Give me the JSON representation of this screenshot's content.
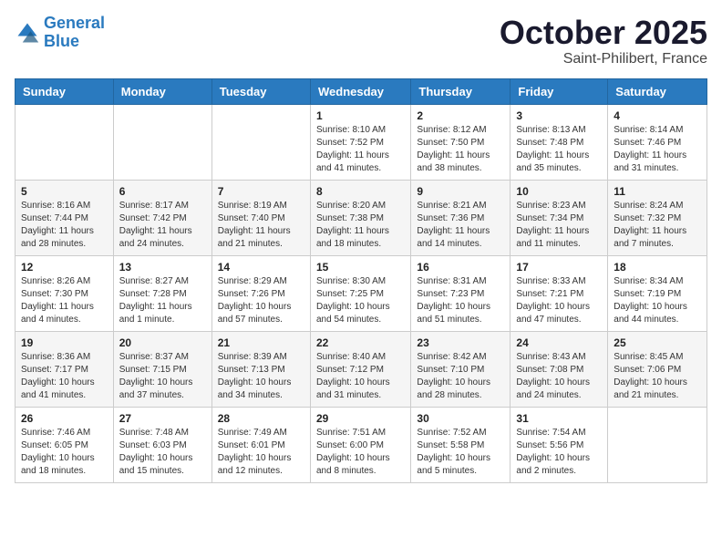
{
  "header": {
    "logo_line1": "General",
    "logo_line2": "Blue",
    "month": "October 2025",
    "location": "Saint-Philibert, France"
  },
  "weekdays": [
    "Sunday",
    "Monday",
    "Tuesday",
    "Wednesday",
    "Thursday",
    "Friday",
    "Saturday"
  ],
  "weeks": [
    [
      {
        "day": "",
        "info": ""
      },
      {
        "day": "",
        "info": ""
      },
      {
        "day": "",
        "info": ""
      },
      {
        "day": "1",
        "info": "Sunrise: 8:10 AM\nSunset: 7:52 PM\nDaylight: 11 hours\nand 41 minutes."
      },
      {
        "day": "2",
        "info": "Sunrise: 8:12 AM\nSunset: 7:50 PM\nDaylight: 11 hours\nand 38 minutes."
      },
      {
        "day": "3",
        "info": "Sunrise: 8:13 AM\nSunset: 7:48 PM\nDaylight: 11 hours\nand 35 minutes."
      },
      {
        "day": "4",
        "info": "Sunrise: 8:14 AM\nSunset: 7:46 PM\nDaylight: 11 hours\nand 31 minutes."
      }
    ],
    [
      {
        "day": "5",
        "info": "Sunrise: 8:16 AM\nSunset: 7:44 PM\nDaylight: 11 hours\nand 28 minutes."
      },
      {
        "day": "6",
        "info": "Sunrise: 8:17 AM\nSunset: 7:42 PM\nDaylight: 11 hours\nand 24 minutes."
      },
      {
        "day": "7",
        "info": "Sunrise: 8:19 AM\nSunset: 7:40 PM\nDaylight: 11 hours\nand 21 minutes."
      },
      {
        "day": "8",
        "info": "Sunrise: 8:20 AM\nSunset: 7:38 PM\nDaylight: 11 hours\nand 18 minutes."
      },
      {
        "day": "9",
        "info": "Sunrise: 8:21 AM\nSunset: 7:36 PM\nDaylight: 11 hours\nand 14 minutes."
      },
      {
        "day": "10",
        "info": "Sunrise: 8:23 AM\nSunset: 7:34 PM\nDaylight: 11 hours\nand 11 minutes."
      },
      {
        "day": "11",
        "info": "Sunrise: 8:24 AM\nSunset: 7:32 PM\nDaylight: 11 hours\nand 7 minutes."
      }
    ],
    [
      {
        "day": "12",
        "info": "Sunrise: 8:26 AM\nSunset: 7:30 PM\nDaylight: 11 hours\nand 4 minutes."
      },
      {
        "day": "13",
        "info": "Sunrise: 8:27 AM\nSunset: 7:28 PM\nDaylight: 11 hours\nand 1 minute."
      },
      {
        "day": "14",
        "info": "Sunrise: 8:29 AM\nSunset: 7:26 PM\nDaylight: 10 hours\nand 57 minutes."
      },
      {
        "day": "15",
        "info": "Sunrise: 8:30 AM\nSunset: 7:25 PM\nDaylight: 10 hours\nand 54 minutes."
      },
      {
        "day": "16",
        "info": "Sunrise: 8:31 AM\nSunset: 7:23 PM\nDaylight: 10 hours\nand 51 minutes."
      },
      {
        "day": "17",
        "info": "Sunrise: 8:33 AM\nSunset: 7:21 PM\nDaylight: 10 hours\nand 47 minutes."
      },
      {
        "day": "18",
        "info": "Sunrise: 8:34 AM\nSunset: 7:19 PM\nDaylight: 10 hours\nand 44 minutes."
      }
    ],
    [
      {
        "day": "19",
        "info": "Sunrise: 8:36 AM\nSunset: 7:17 PM\nDaylight: 10 hours\nand 41 minutes."
      },
      {
        "day": "20",
        "info": "Sunrise: 8:37 AM\nSunset: 7:15 PM\nDaylight: 10 hours\nand 37 minutes."
      },
      {
        "day": "21",
        "info": "Sunrise: 8:39 AM\nSunset: 7:13 PM\nDaylight: 10 hours\nand 34 minutes."
      },
      {
        "day": "22",
        "info": "Sunrise: 8:40 AM\nSunset: 7:12 PM\nDaylight: 10 hours\nand 31 minutes."
      },
      {
        "day": "23",
        "info": "Sunrise: 8:42 AM\nSunset: 7:10 PM\nDaylight: 10 hours\nand 28 minutes."
      },
      {
        "day": "24",
        "info": "Sunrise: 8:43 AM\nSunset: 7:08 PM\nDaylight: 10 hours\nand 24 minutes."
      },
      {
        "day": "25",
        "info": "Sunrise: 8:45 AM\nSunset: 7:06 PM\nDaylight: 10 hours\nand 21 minutes."
      }
    ],
    [
      {
        "day": "26",
        "info": "Sunrise: 7:46 AM\nSunset: 6:05 PM\nDaylight: 10 hours\nand 18 minutes."
      },
      {
        "day": "27",
        "info": "Sunrise: 7:48 AM\nSunset: 6:03 PM\nDaylight: 10 hours\nand 15 minutes."
      },
      {
        "day": "28",
        "info": "Sunrise: 7:49 AM\nSunset: 6:01 PM\nDaylight: 10 hours\nand 12 minutes."
      },
      {
        "day": "29",
        "info": "Sunrise: 7:51 AM\nSunset: 6:00 PM\nDaylight: 10 hours\nand 8 minutes."
      },
      {
        "day": "30",
        "info": "Sunrise: 7:52 AM\nSunset: 5:58 PM\nDaylight: 10 hours\nand 5 minutes."
      },
      {
        "day": "31",
        "info": "Sunrise: 7:54 AM\nSunset: 5:56 PM\nDaylight: 10 hours\nand 2 minutes."
      },
      {
        "day": "",
        "info": ""
      }
    ]
  ]
}
